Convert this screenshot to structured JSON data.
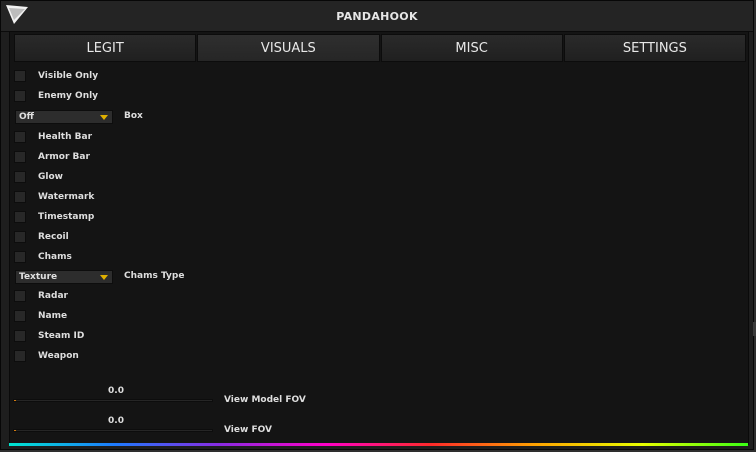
{
  "title": "PANDAHOOK",
  "tabs": [
    {
      "label": "LEGIT"
    },
    {
      "label": "VISUALS"
    },
    {
      "label": "MISC"
    },
    {
      "label": "SETTINGS"
    }
  ],
  "active_tab": "VISUALS",
  "checkboxes": {
    "visible_only": "Visible Only",
    "enemy_only": "Enemy Only",
    "health_bar": "Health Bar",
    "armor_bar": "Armor Bar",
    "glow": "Glow",
    "watermark": "Watermark",
    "timestamp": "Timestamp",
    "recoil": "Recoil",
    "chams": "Chams",
    "radar": "Radar",
    "name": "Name",
    "steam_id": "Steam ID",
    "weapon": "Weapon"
  },
  "box_dropdown": {
    "value": "Off",
    "label": "Box"
  },
  "chams_dropdown": {
    "value": "Texture",
    "label": "Chams Type"
  },
  "sliders": {
    "view_model_fov": {
      "value": "0.0",
      "label": "View Model FOV",
      "fill": 0.01
    },
    "view_fov": {
      "value": "0.0",
      "label": "View FOV",
      "fill": 0.01
    }
  },
  "colors": {
    "accent": "#e0b000",
    "slider": "#d07a10",
    "background": "#141414"
  }
}
